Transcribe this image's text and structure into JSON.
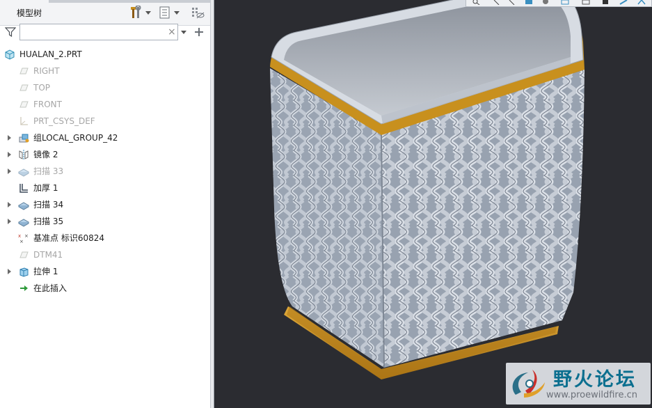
{
  "panel": {
    "title": "模型树",
    "search": {
      "value": "",
      "placeholder": "",
      "clear": "×"
    }
  },
  "tree": {
    "root": {
      "label": "HUALAN_2.PRT"
    },
    "items": [
      {
        "label": "RIGHT",
        "icon": "datum-plane-icon",
        "dim": true,
        "expandable": false
      },
      {
        "label": "TOP",
        "icon": "datum-plane-icon",
        "dim": true,
        "expandable": false
      },
      {
        "label": "FRONT",
        "icon": "datum-plane-icon",
        "dim": true,
        "expandable": false
      },
      {
        "label": "PRT_CSYS_DEF",
        "icon": "coordinate-system-icon",
        "dim": true,
        "expandable": false
      },
      {
        "label": "组LOCAL_GROUP_42",
        "icon": "group-icon",
        "dim": false,
        "expandable": true
      },
      {
        "label": "镜像 2",
        "icon": "mirror-icon",
        "dim": false,
        "expandable": true
      },
      {
        "label": "扫描 33",
        "icon": "sweep-icon",
        "dim": true,
        "expandable": true
      },
      {
        "label": "加厚 1",
        "icon": "thicken-icon",
        "dim": false,
        "expandable": false
      },
      {
        "label": "扫描 34",
        "icon": "sweep-icon",
        "dim": false,
        "expandable": true
      },
      {
        "label": "扫描 35",
        "icon": "sweep-icon",
        "dim": false,
        "expandable": true
      },
      {
        "label": "基准点 标识60824",
        "icon": "datum-point-icon",
        "dim": false,
        "expandable": false
      },
      {
        "label": "DTM41",
        "icon": "datum-plane-icon",
        "dim": true,
        "expandable": false
      },
      {
        "label": "拉伸 1",
        "icon": "extrude-icon",
        "dim": false,
        "expandable": true
      },
      {
        "label": "在此插入",
        "icon": "insert-here-arrow-icon",
        "dim": false,
        "expandable": false
      }
    ]
  },
  "watermark": {
    "title": "野火论坛",
    "url": "www.proewildfire.cn"
  },
  "colors": {
    "accent": "#0b6f8f",
    "model_gold": "#c8901e",
    "model_weave": "#a9b2bf",
    "background": "#2b2c31"
  }
}
